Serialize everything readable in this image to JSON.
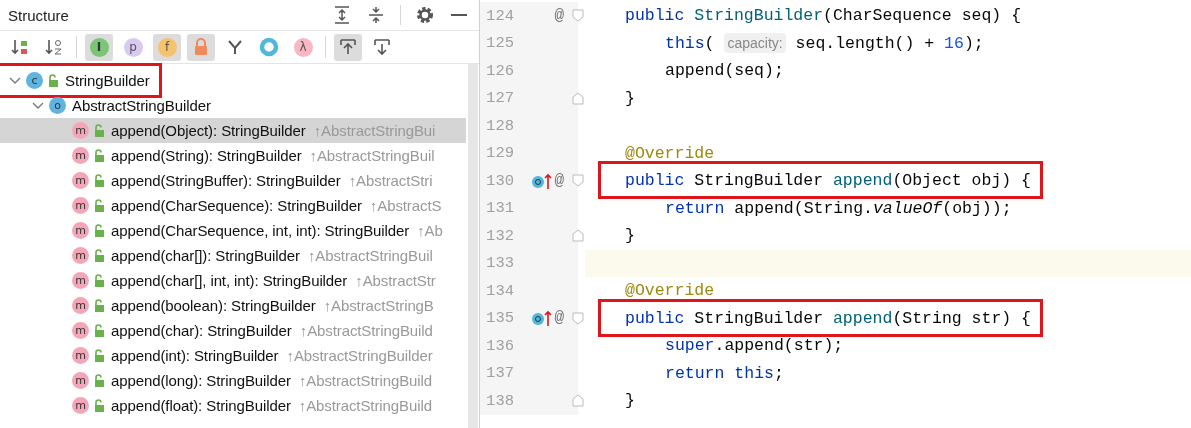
{
  "panel": {
    "title": "Structure",
    "toolbar": [
      {
        "kind": "sort-visibility",
        "separated": false,
        "on": false
      },
      {
        "kind": "sort-alpha",
        "separated": false,
        "on": false
      },
      {
        "kind": "inherited",
        "separated": true,
        "glyph": "I",
        "on": true
      },
      {
        "kind": "properties",
        "separated": false,
        "glyph": "p",
        "on": false
      },
      {
        "kind": "fields",
        "separated": false,
        "glyph": "f",
        "on": true
      },
      {
        "kind": "non-public",
        "separated": false,
        "on": true
      },
      {
        "kind": "hierarchy",
        "separated": false,
        "on": false
      },
      {
        "kind": "anonymous",
        "separated": false,
        "on": false
      },
      {
        "kind": "lambdas",
        "separated": false,
        "glyph": "λ",
        "on": false
      },
      {
        "kind": "scroll-to-source",
        "separated": true,
        "on": true
      },
      {
        "kind": "scroll-from-source",
        "separated": false,
        "on": false
      }
    ],
    "tree": [
      {
        "label": "StringBuilder",
        "kind": "class",
        "badge": "c",
        "expanded": true,
        "selected": false,
        "highlighted": true,
        "children": [
          {
            "label": "AbstractStringBuilder",
            "kind": "superclass",
            "badge": "o",
            "expanded": true,
            "selected": false,
            "highlighted": false,
            "children": [
              {
                "label": "append(Object): StringBuilder",
                "origin": "↑AbstractStringBui",
                "kind": "method",
                "badge": "m",
                "selected": true,
                "highlighted": false
              },
              {
                "label": "append(String): StringBuilder",
                "origin": "↑AbstractStringBuil",
                "kind": "method",
                "badge": "m",
                "selected": false,
                "highlighted": false
              },
              {
                "label": "append(StringBuffer): StringBuilder",
                "origin": "↑AbstractStri",
                "kind": "method",
                "badge": "m",
                "selected": false,
                "highlighted": false
              },
              {
                "label": "append(CharSequence): StringBuilder",
                "origin": "↑AbstractS",
                "kind": "method",
                "badge": "m",
                "selected": false,
                "highlighted": false
              },
              {
                "label": "append(CharSequence, int, int): StringBuilder",
                "origin": "↑Ab",
                "kind": "method",
                "badge": "m",
                "selected": false,
                "highlighted": false
              },
              {
                "label": "append(char[]): StringBuilder",
                "origin": "↑AbstractStringBuil",
                "kind": "method",
                "badge": "m",
                "selected": false,
                "highlighted": false
              },
              {
                "label": "append(char[], int, int): StringBuilder",
                "origin": "↑AbstractStr",
                "kind": "method",
                "badge": "m",
                "selected": false,
                "highlighted": false
              },
              {
                "label": "append(boolean): StringBuilder",
                "origin": "↑AbstractStringB",
                "kind": "method",
                "badge": "m",
                "selected": false,
                "highlighted": false
              },
              {
                "label": "append(char): StringBuilder",
                "origin": "↑AbstractStringBuild",
                "kind": "method",
                "badge": "m",
                "selected": false,
                "highlighted": false
              },
              {
                "label": "append(int): StringBuilder",
                "origin": "↑AbstractStringBuilder",
                "kind": "method",
                "badge": "m",
                "selected": false,
                "highlighted": false
              },
              {
                "label": "append(long): StringBuilder",
                "origin": "↑AbstractStringBuild",
                "kind": "method",
                "badge": "m",
                "selected": false,
                "highlighted": false
              },
              {
                "label": "append(float): StringBuilder",
                "origin": "↑AbstractStringBuild",
                "kind": "method",
                "badge": "m",
                "selected": false,
                "highlighted": false
              }
            ]
          }
        ]
      }
    ]
  },
  "editor": {
    "lines": [
      {
        "number": "124",
        "kind": "member",
        "gutter": "@",
        "overrides": false,
        "current": false,
        "highlighted": false,
        "fold_start": true,
        "fold_end": false,
        "tokens": [
          {
            "kind": "keyword",
            "text": "public"
          },
          {
            "kind": "declaration",
            "text": " StringBuilder"
          },
          {
            "kind": "plain",
            "text": "(CharSequence seq) {"
          }
        ]
      },
      {
        "number": "125",
        "kind": "body",
        "overrides": false,
        "current": false,
        "highlighted": false,
        "fold_start": false,
        "fold_end": false,
        "tokens": [
          {
            "kind": "keyword",
            "text": "this"
          },
          {
            "kind": "plain",
            "text": "( "
          },
          {
            "kind": "hint",
            "text": "capacity:"
          },
          {
            "kind": "plain",
            "text": " seq.length() + "
          },
          {
            "kind": "number",
            "text": "16"
          },
          {
            "kind": "plain",
            "text": ");"
          }
        ]
      },
      {
        "number": "126",
        "kind": "body",
        "overrides": false,
        "current": false,
        "highlighted": false,
        "fold_start": false,
        "fold_end": false,
        "tokens": [
          {
            "kind": "plain",
            "text": "append(seq);"
          }
        ]
      },
      {
        "number": "127",
        "kind": "member",
        "overrides": false,
        "current": false,
        "highlighted": false,
        "fold_start": false,
        "fold_end": true,
        "tokens": [
          {
            "kind": "plain",
            "text": "}"
          }
        ]
      },
      {
        "number": "128",
        "kind": "member",
        "overrides": false,
        "current": false,
        "highlighted": false,
        "fold_start": false,
        "fold_end": false
      },
      {
        "number": "129",
        "kind": "member",
        "overrides": false,
        "current": false,
        "highlighted": false,
        "fold_start": false,
        "fold_end": false,
        "tokens": [
          {
            "kind": "annotation",
            "text": "@Override"
          }
        ]
      },
      {
        "number": "130",
        "kind": "member",
        "gutter": "@",
        "overrides": true,
        "current": false,
        "highlighted": true,
        "fold_start": true,
        "fold_end": false,
        "tokens": [
          {
            "kind": "keyword",
            "text": "public"
          },
          {
            "kind": "plain",
            "text": " StringBuilder "
          },
          {
            "kind": "declaration",
            "text": "append"
          },
          {
            "kind": "plain",
            "text": "(Object obj) {"
          }
        ]
      },
      {
        "number": "131",
        "kind": "body",
        "overrides": false,
        "current": false,
        "highlighted": false,
        "fold_start": false,
        "fold_end": false,
        "tokens": [
          {
            "kind": "keyword",
            "text": "return"
          },
          {
            "kind": "plain",
            "text": " append(String."
          },
          {
            "kind": "static",
            "text": "valueOf"
          },
          {
            "kind": "plain",
            "text": "(obj));"
          }
        ]
      },
      {
        "number": "132",
        "kind": "member",
        "overrides": false,
        "current": false,
        "highlighted": false,
        "fold_start": false,
        "fold_end": true,
        "tokens": [
          {
            "kind": "plain",
            "text": "}"
          }
        ]
      },
      {
        "number": "133",
        "kind": "member",
        "overrides": false,
        "current": true,
        "highlighted": false,
        "fold_start": false,
        "fold_end": false
      },
      {
        "number": "134",
        "kind": "member",
        "overrides": false,
        "current": false,
        "highlighted": false,
        "fold_start": false,
        "fold_end": false,
        "tokens": [
          {
            "kind": "annotation",
            "text": "@Override"
          }
        ]
      },
      {
        "number": "135",
        "kind": "member",
        "gutter": "@",
        "overrides": true,
        "current": false,
        "highlighted": true,
        "fold_start": true,
        "fold_end": false,
        "tokens": [
          {
            "kind": "keyword",
            "text": "public"
          },
          {
            "kind": "plain",
            "text": " StringBuilder "
          },
          {
            "kind": "declaration",
            "text": "append"
          },
          {
            "kind": "plain",
            "text": "(String str) {"
          }
        ]
      },
      {
        "number": "136",
        "kind": "body",
        "overrides": false,
        "current": false,
        "highlighted": false,
        "fold_start": false,
        "fold_end": false,
        "tokens": [
          {
            "kind": "keyword",
            "text": "super"
          },
          {
            "kind": "plain",
            "text": ".append(str);"
          }
        ]
      },
      {
        "number": "137",
        "kind": "body",
        "overrides": false,
        "current": false,
        "highlighted": false,
        "fold_start": false,
        "fold_end": false,
        "tokens": [
          {
            "kind": "keyword",
            "text": "return"
          },
          {
            "kind": "keyword",
            "text": " this"
          },
          {
            "kind": "plain",
            "text": ";"
          }
        ]
      },
      {
        "number": "138",
        "kind": "member",
        "overrides": false,
        "current": false,
        "highlighted": false,
        "fold_start": false,
        "fold_end": true,
        "tokens": [
          {
            "kind": "plain",
            "text": "}"
          }
        ]
      }
    ]
  }
}
